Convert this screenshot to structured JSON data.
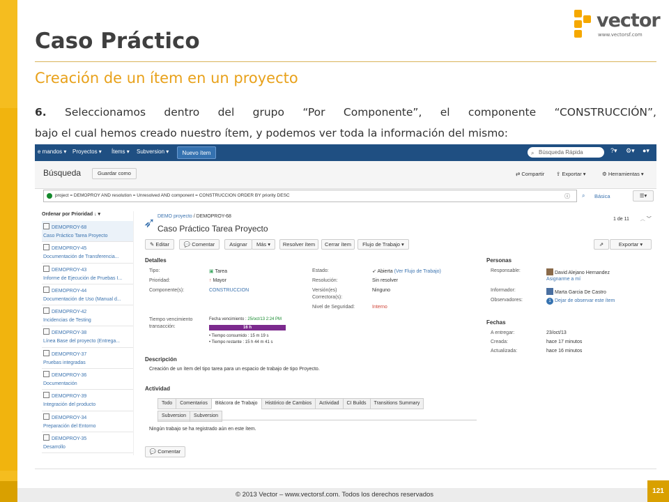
{
  "slide": {
    "title": "Caso Práctico",
    "subtitle": "Creación de un ítem en un proyecto",
    "step_num": "6.",
    "step_text": " Seleccionamos dentro del grupo “Por Componente”, el componente “CONSTRUCCIÓN”,",
    "step_text2": "bajo el cual hemos creado nuestro ítem, y podemos ver toda la información del mismo:",
    "footer": "© 2013 Vector – www.vectorsf.com. Todos los derechos reservados",
    "page_number": "121",
    "logo": {
      "word": "vector",
      "url": "www.vectorsf.com"
    }
  },
  "colors": {
    "accent": "#f5bd1f",
    "nav": "#1f4f82",
    "link": "#3b73af",
    "bar": "#7c2a8e"
  },
  "app": {
    "nav": [
      "e mandos ▾",
      "Proyectos ▾",
      "Ítems ▾",
      "Subversion ▾"
    ],
    "new_item": "Nuevo ítem",
    "quick_search": "Búsqueda Rápida",
    "search_title": "Búsqueda",
    "save_as": "Guardar como",
    "share": "Compartir",
    "export": "Exportar ▾",
    "tools": "Herramientas ▾",
    "query": "project = DEMOPROY AND resolution = Unresolved AND component = CONSTRUCCION ORDER BY priority DESC",
    "basic": "Básica",
    "order_by": "Ordenar por Prioridad ↓",
    "issues": [
      {
        "key": "DEMOPROY-68",
        "summary": "Caso Práctico Tarea Proyecto"
      },
      {
        "key": "DEMOPROY-45",
        "summary": "Documentación de Transferencia..."
      },
      {
        "key": "DEMOPROY-43",
        "summary": "Informe de Ejecución de Pruebas I..."
      },
      {
        "key": "DEMOPROY-44",
        "summary": "Documentación de Uso (Manual d..."
      },
      {
        "key": "DEMOPROY-42",
        "summary": "Incidencias de Testing"
      },
      {
        "key": "DEMOPROY-38",
        "summary": "Línea Base del proyecto (Entrega..."
      },
      {
        "key": "DEMOPROY-37",
        "summary": "Pruebas integradas"
      },
      {
        "key": "DEMOPROY-36",
        "summary": "Documentación"
      },
      {
        "key": "DEMOPROY-39",
        "summary": "Integración del producto"
      },
      {
        "key": "DEMOPROY-34",
        "summary": "Preparación del Entorno"
      },
      {
        "key": "DEMOPROY-35",
        "summary": "Desarrollo"
      }
    ],
    "breadcrumb_project": "DEMO proyecto",
    "breadcrumb_sep": " / ",
    "breadcrumb_key": "DEMOPROY-68",
    "issue_title": "Caso Práctico Tarea Proyecto",
    "pager": "1 de 11",
    "actions": [
      "✎ Editar",
      "💬 Comentar",
      "Asignar",
      "Más ▾",
      "Resolver ítem",
      "Cerrar ítem",
      "Flujo de Trabajo ▾"
    ],
    "export2": "Exportar ▾",
    "details_label": "Detalles",
    "details": {
      "tipo_l": "Tipo:",
      "tipo_v": "Tarea",
      "prio_l": "Prioridad:",
      "prio_v": "Mayor",
      "comp_l": "Componente(s):",
      "comp_v": "CONSTRUCCION",
      "estado_l": "Estado:",
      "estado_v": "Abierta",
      "estado_link": "(Ver Flujo de Trabajo)",
      "res_l": "Resolución:",
      "res_v": "Sin resolver",
      "ver_l": "Versión(es)",
      "ver_l2": "Correctora(s):",
      "ver_v": "Ninguno",
      "seg_l": "Nivel de Seguridad:",
      "seg_v": "Interno",
      "tv_l": "Tiempo vencimiento",
      "tv_l2": "transacción:",
      "fecha_v": "Fecha vencimiento : ",
      "fecha_d": "25/oct/13 2:24 PM",
      "bar": "16 h",
      "consumido": "• Tiempo consumido : 15 m 19 s",
      "restante": "• Tiempo restante : 15 h 44 m 41 s"
    },
    "people_label": "Personas",
    "people": {
      "resp_l": "Responsable:",
      "resp_v": "David Alejano Hernandez",
      "assign_me": "Asignarme a mí",
      "inf_l": "Informador:",
      "inf_v": "Marta Garcia De Castro",
      "obs_l": "Observadores:",
      "obs_count": "1",
      "obs_v": "Dejar de observar este ítem"
    },
    "dates_label": "Fechas",
    "dates": {
      "ent_l": "A entregar:",
      "ent_v": "23/oct/13",
      "crea_l": "Creada:",
      "crea_v": "hace 17 minutos",
      "act_l": "Actualizada:",
      "act_v": "hace 16 minutos"
    },
    "desc_label": "Descripción",
    "desc": "Creación de un ítem del tipo tarea para un espacio de trabajo de tipo Proyecto.",
    "activity_label": "Actividad",
    "tabs": [
      "Todo",
      "Comentarios",
      "Bitácora de Trabajo",
      "Histórico de Cambios",
      "Actividad",
      "CI Builds",
      "Transitions Summary"
    ],
    "tabs2": [
      "Subversion",
      "Subversion"
    ],
    "no_work": "Ningún trabajo se ha registrado aún en este ítem.",
    "comment": "💬 Comentar"
  }
}
